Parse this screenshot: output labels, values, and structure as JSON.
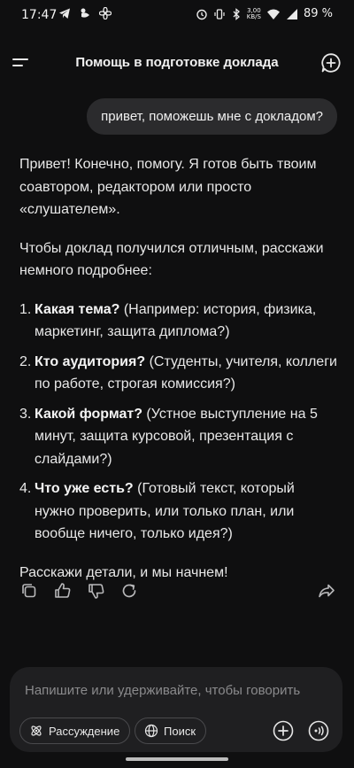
{
  "status_bar": {
    "time": "17:47",
    "net_speed_value": "3,00",
    "net_speed_unit": "KB/S",
    "battery": "89 %"
  },
  "header": {
    "title": "Помощь в подготовке доклада",
    "menu_icon": "menu-icon",
    "new_chat_icon": "new-chat-icon"
  },
  "user_message": "привет, поможешь мне с докладом?",
  "assistant": {
    "intro": "Привет! Конечно, помогу. Я готов быть твоим соавтором, редактором или просто «слушателем».",
    "question": "Чтобы доклад получился отличным, расскажи немного подробнее:",
    "items": [
      {
        "num": "1.",
        "title": "Какая тема?",
        "text": " (Например: история, физика, маркетинг, защита диплома?)"
      },
      {
        "num": "2.",
        "title": "Кто аудитория?",
        "text": " (Студенты, учителя, коллеги по работе, строгая комиссия?)"
      },
      {
        "num": "3.",
        "title": "Какой формат?",
        "text": " (Устное выступление на 5 минут, защита курсовой, презентация с слайдами?)"
      },
      {
        "num": "4.",
        "title": "Что уже есть?",
        "text": " (Готовый текст, который нужно проверить, или только план, или вообще ничего, только идея?)"
      }
    ],
    "closing": "Расскажи детали, и мы начнем!"
  },
  "actions": [
    "copy-icon",
    "thumbs-up-icon",
    "thumbs-down-icon",
    "regenerate-icon",
    "share-icon"
  ],
  "composer": {
    "placeholder": "Напишите или удерживайте, чтобы говорить",
    "chip_reasoning": "Рассуждение",
    "chip_search": "Поиск"
  },
  "colors": {
    "background": "#0f0f10",
    "bubble": "#2b2b2d",
    "composer": "#1f1f21"
  }
}
